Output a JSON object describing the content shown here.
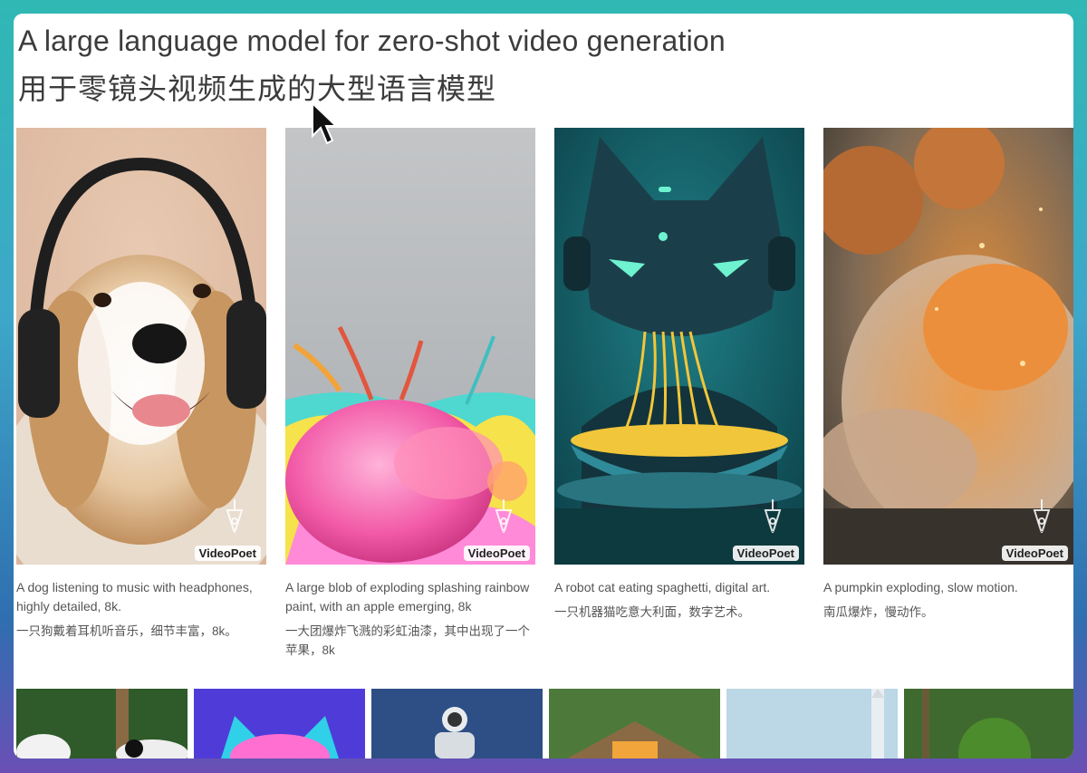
{
  "header": {
    "title_en": "A large language model for zero-shot video generation",
    "title_zh": "用于零镜头视频生成的大型语言模型"
  },
  "watermark": "VideoPoet",
  "cards": [
    {
      "icon": "dog-headphones-image",
      "caption_en": "A dog listening to music with headphones, highly detailed, 8k.",
      "caption_zh": "一只狗戴着耳机听音乐，细节丰富，8k。"
    },
    {
      "icon": "exploding-paint-apple-image",
      "caption_en": "A large blob of exploding splashing rainbow paint, with an apple emerging, 8k",
      "caption_zh": "一大团爆炸飞溅的彩虹油漆，其中出现了一个苹果，8k"
    },
    {
      "icon": "robot-cat-spaghetti-image",
      "caption_en": "A robot cat eating spaghetti, digital art.",
      "caption_zh": "一只机器猫吃意大利面，数字艺术。"
    },
    {
      "icon": "pumpkin-exploding-image",
      "caption_en": "A pumpkin exploding, slow motion.",
      "caption_zh": "南瓜爆炸，慢动作。"
    }
  ],
  "strip": [
    {
      "icon": "panda-thumbnail"
    },
    {
      "icon": "neon-cat-thumbnail"
    },
    {
      "icon": "astronaut-thumbnail"
    },
    {
      "icon": "cabin-thumbnail"
    },
    {
      "icon": "rocket-thumbnail"
    },
    {
      "icon": "forest-thumbnail"
    }
  ],
  "colors": {
    "background": "#2fb8b4",
    "page": "#ffffff",
    "title_text": "#3c3c3c",
    "caption_text": "#555555"
  }
}
